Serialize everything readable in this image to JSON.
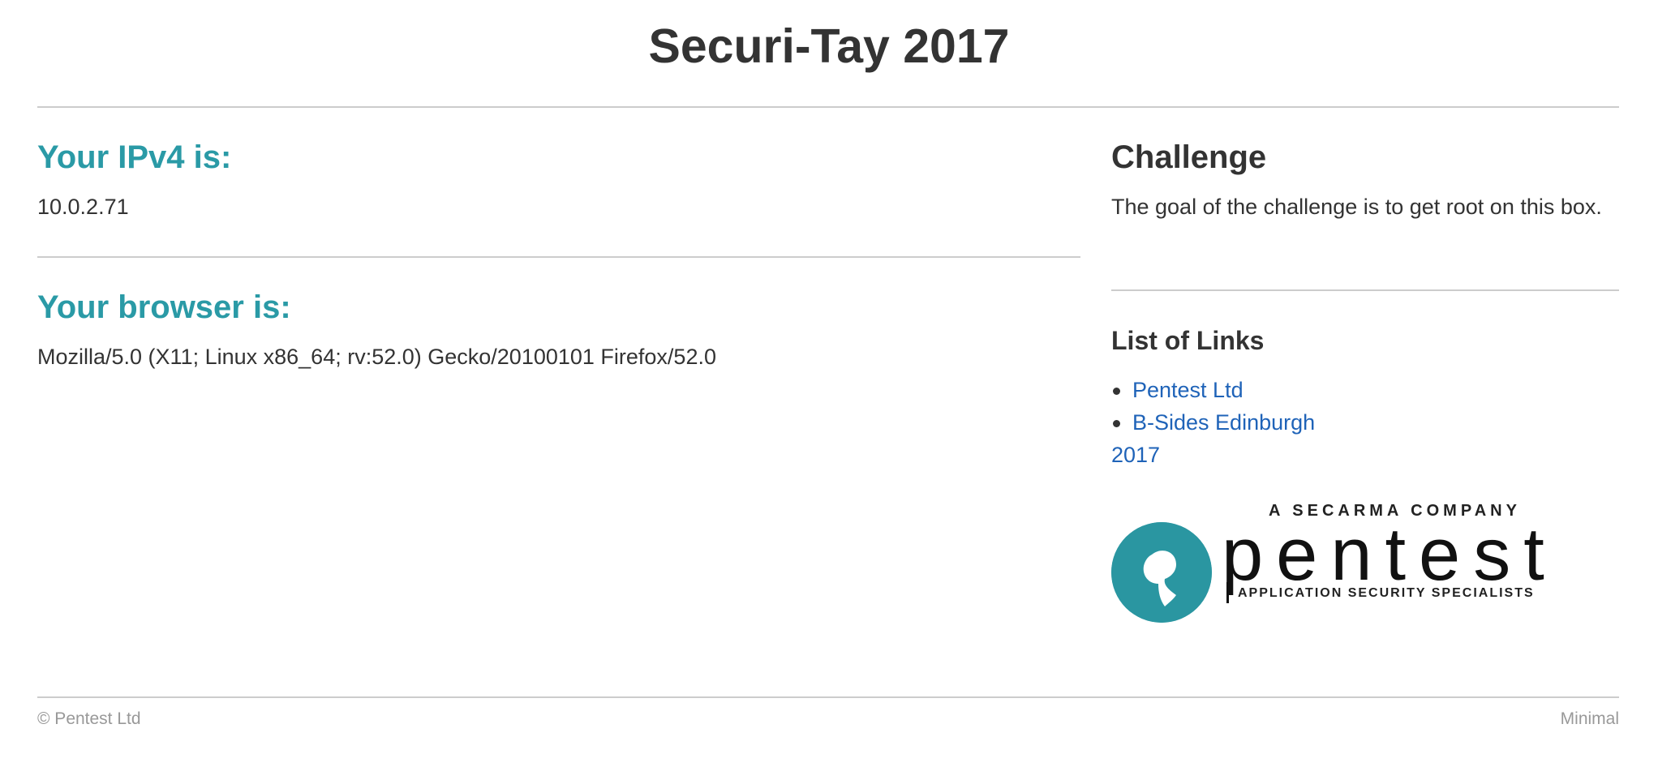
{
  "header": {
    "title": "Securi-Tay 2017"
  },
  "main": {
    "ip_heading": "Your IPv4 is:",
    "ip_value": "10.0.2.71",
    "browser_heading": "Your browser is:",
    "browser_value": "Mozilla/5.0 (X11; Linux x86_64; rv:52.0) Gecko/20100101 Firefox/52.0"
  },
  "sidebar": {
    "challenge_heading": "Challenge",
    "challenge_text": "The goal of the challenge is to get root on this box.",
    "links_heading": "List of Links",
    "links": [
      {
        "label": "Pentest Ltd"
      },
      {
        "label": "B-Sides Edinburgh 2017"
      }
    ],
    "logo": {
      "tagline": "A SECARMA COMPANY",
      "wordmark": "pentest",
      "subtitle": "APPLICATION SECURITY SPECIALISTS",
      "brand_color": "#2a96a1"
    }
  },
  "footer": {
    "copyright": "© Pentest Ltd",
    "theme": "Minimal"
  },
  "colors": {
    "accent": "#2a9aa6",
    "link": "#1f63b8",
    "text": "#333333",
    "muted": "#999999"
  }
}
